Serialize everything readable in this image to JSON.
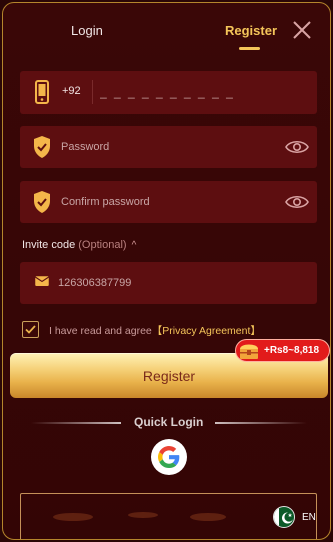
{
  "tabs": {
    "login": "Login",
    "register": "Register"
  },
  "phone": {
    "country_code": "+92",
    "placeholder": "_ _ _ _ _ _ _ _ _ _"
  },
  "password": {
    "placeholder": "Password"
  },
  "confirm_password": {
    "placeholder": "Confirm password"
  },
  "invite": {
    "label": "Invite code",
    "optional": "(Optional)",
    "value": "126306387799"
  },
  "agreement": {
    "text": "I have read and agree",
    "link": "【Privacy Agreement】"
  },
  "register_button": {
    "label": "Register"
  },
  "reward_badge": {
    "text": "+Rs8~8,818"
  },
  "quick_login": {
    "label": "Quick Login"
  },
  "language": {
    "code": "EN"
  },
  "colors": {
    "accent": "#f4c55a",
    "field_bg": "#5d0e10",
    "panel_bg": "#3a0707",
    "badge": "#e21b1b"
  }
}
